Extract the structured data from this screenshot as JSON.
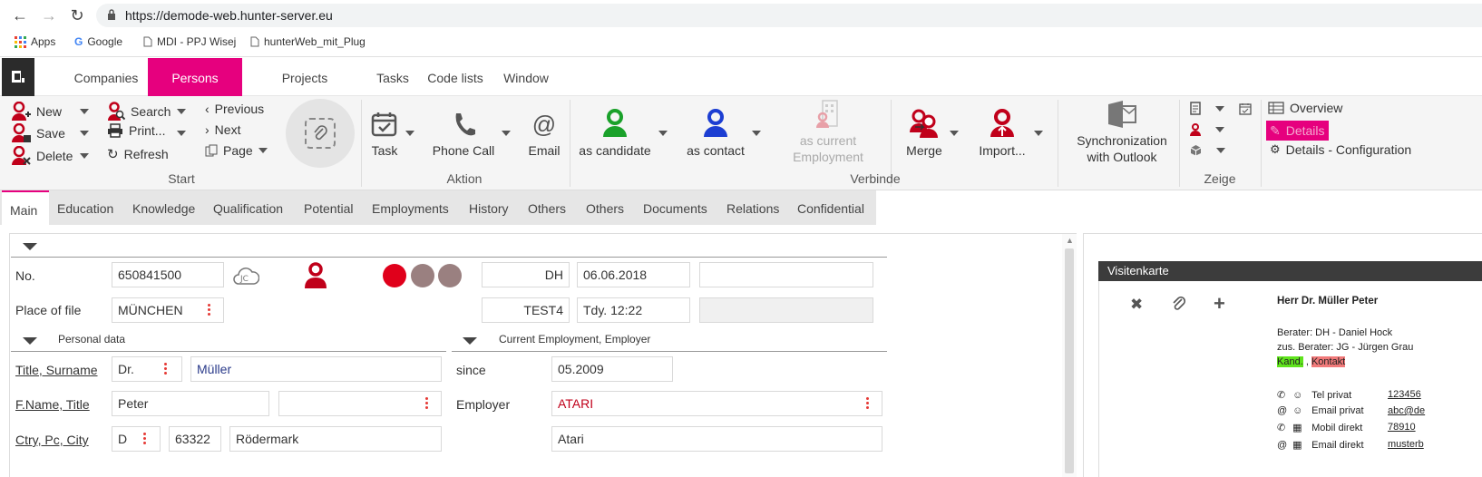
{
  "browser": {
    "url": "https://demode-web.hunter-server.eu",
    "bookmarks": [
      "Apps",
      "Google",
      "MDI - PPJ Wisej",
      "hunterWeb_mit_Plug"
    ]
  },
  "nav": {
    "tabs": [
      "Companies",
      "Persons",
      "Projects",
      "Tasks",
      "Code lists",
      "Window"
    ]
  },
  "ribbon": {
    "start": {
      "new": "New",
      "save": "Save",
      "delete": "Delete",
      "search": "Search",
      "print": "Print...",
      "refresh": "Refresh",
      "previous": "Previous",
      "next": "Next",
      "page": "Page",
      "label": "Start"
    },
    "aktion": {
      "task": "Task",
      "phone_call": "Phone Call",
      "email": "Email",
      "label": "Aktion"
    },
    "verbinde": {
      "as_candidate": "as candidate",
      "as_contact": "as contact",
      "as_current_line1": "as current",
      "as_current_line2": "Employment",
      "merge": "Merge",
      "import": "Import...",
      "sync_line1": "Synchronization",
      "sync_line2": "with Outlook",
      "label": "Verbinde"
    },
    "zeige": {
      "label": "Zeige"
    },
    "right": {
      "overview": "Overview",
      "details": "Details",
      "details_config": "Details - Configuration"
    }
  },
  "subtabs": [
    "Main",
    "Education",
    "Knowledge",
    "Qualification",
    "Potential",
    "Employments",
    "History",
    "Others",
    "Others",
    "Documents",
    "Relations",
    "Confidential"
  ],
  "form": {
    "no_label": "No.",
    "no_value": "650841500",
    "place_label": "Place of file",
    "place_value": "MÜNCHEN",
    "consultant_code": "DH",
    "date": "06.06.2018",
    "test_code": "TEST4",
    "tdy": "Tdy. 12:22",
    "personal_section": "Personal data",
    "employment_section": "Current Employment, Employer",
    "title_surname_label": "Title, Surname",
    "title_value": "Dr.",
    "surname_value": "Müller",
    "fname_label": "F.Name, Title",
    "fname_value": "Peter",
    "ctry_label": "Ctry, Pc, City",
    "ctry_value": "D",
    "pc_value": "63322",
    "city_value": "Rödermark",
    "since_label": "since",
    "since_value": "05.2009",
    "employer_label": "Employer",
    "employer_value": "ATARI",
    "employer_value2": "Atari"
  },
  "card": {
    "title": "Visitenkarte",
    "name": "Herr Dr. Müller Peter",
    "berater": "Berater: DH - Daniel Hock",
    "zus_berater": "zus. Berater: JG - Jürgen Grau",
    "kand": "Kand.",
    "kontakt": "Kontakt",
    "rows": [
      {
        "label": "Tel privat",
        "value": "123456"
      },
      {
        "label": "Email privat",
        "value": "abc@de"
      },
      {
        "label": "Mobil direkt",
        "value": "78910"
      },
      {
        "label": "Email direkt",
        "value": "musterb"
      }
    ]
  },
  "colors": {
    "accent": "#e6007e",
    "status_red": "#e0001b",
    "status_gray": "#9a8080",
    "candidate_green": "#1aa12a",
    "contact_blue": "#1c3ed2",
    "person_red": "#c0001a"
  }
}
